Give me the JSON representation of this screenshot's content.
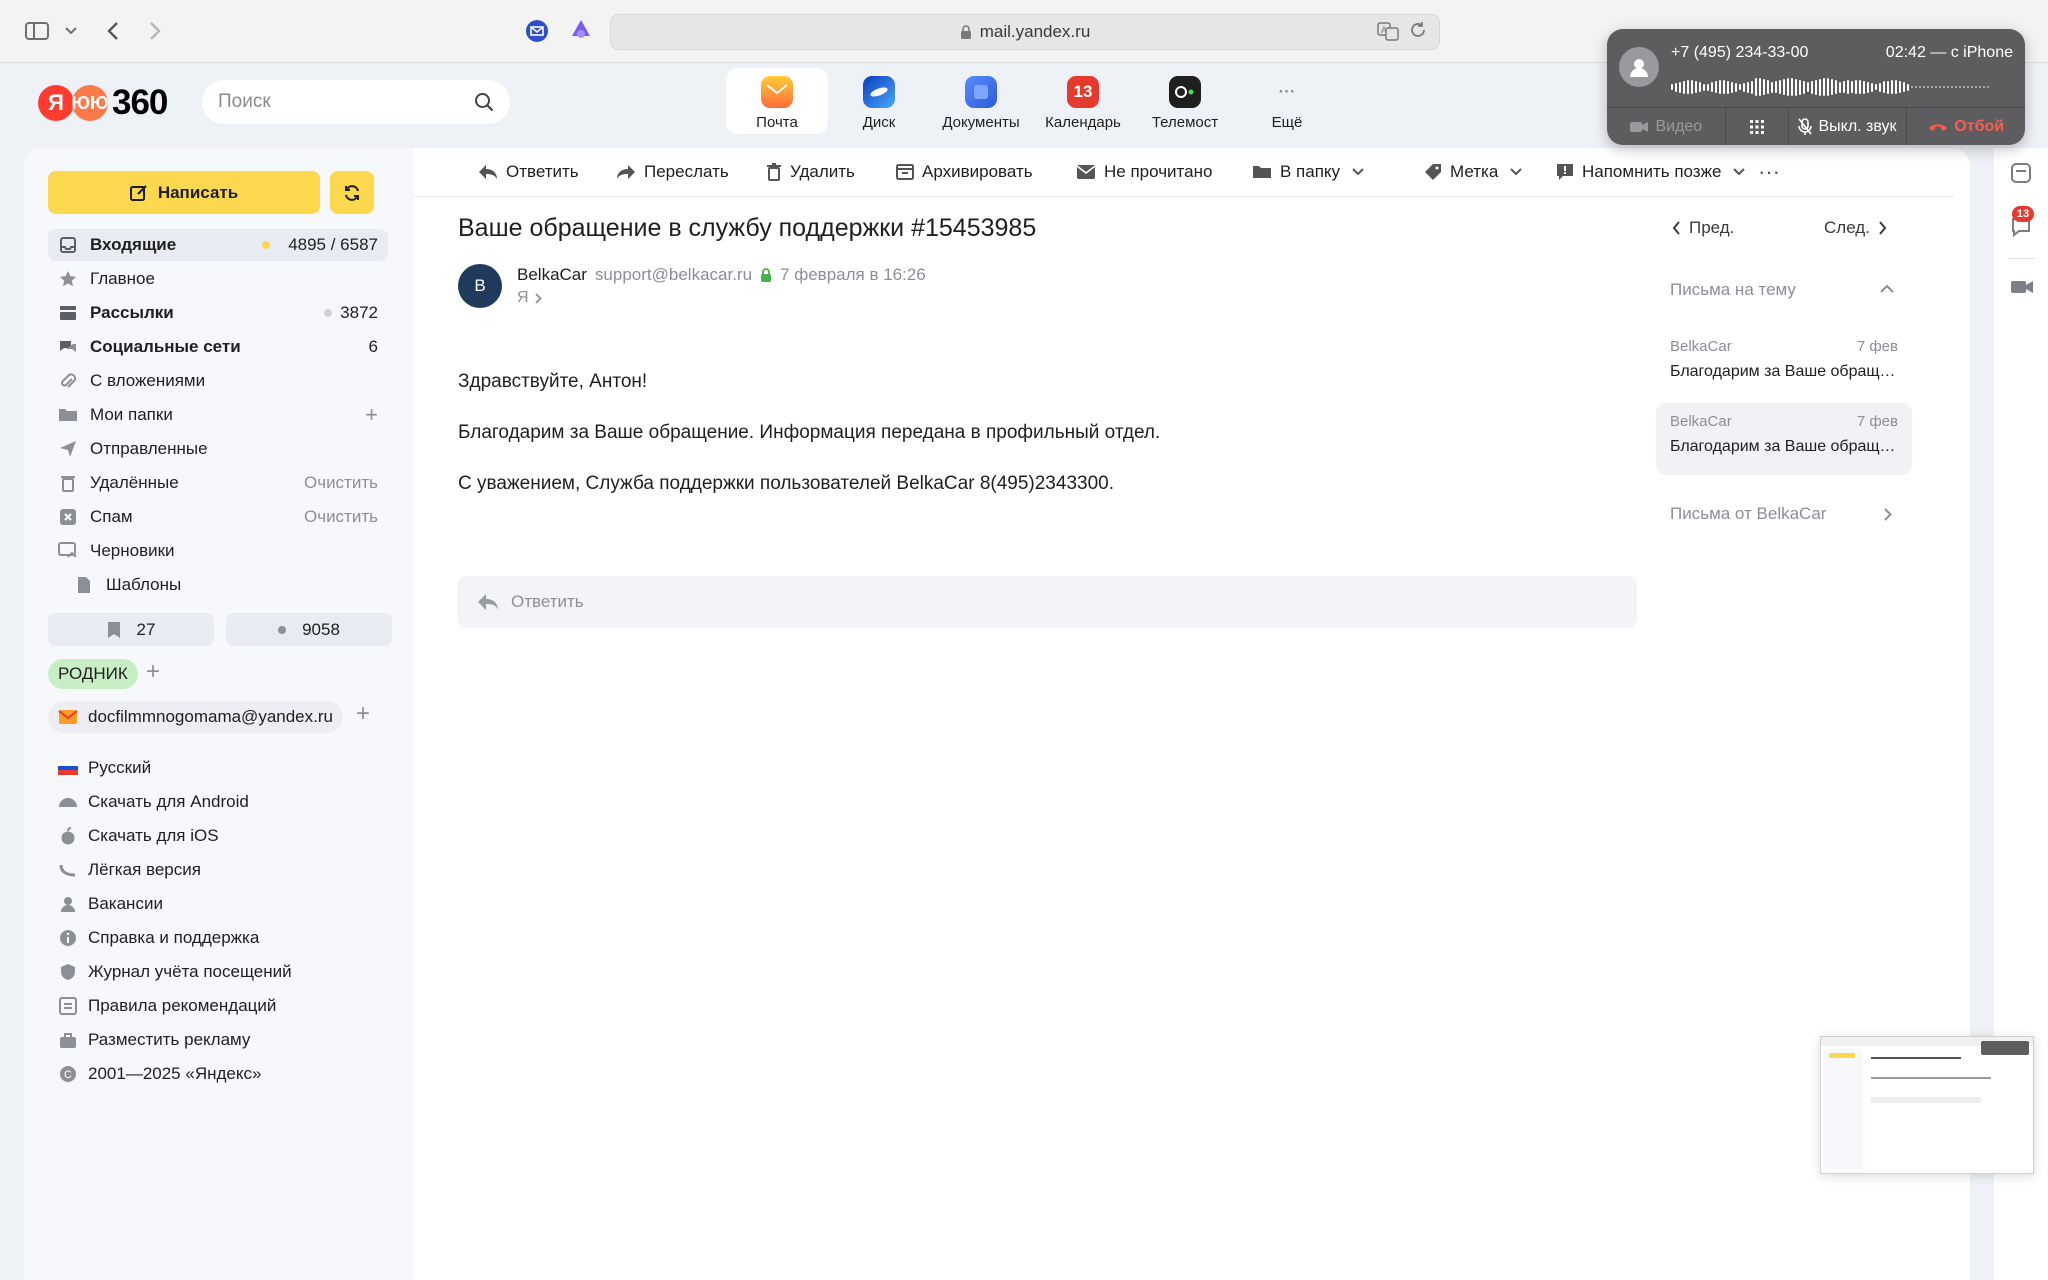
{
  "browser": {
    "url": "mail.yandex.ru"
  },
  "header": {
    "logo_text": "360",
    "logo_letter": "Я",
    "search_placeholder": "Поиск",
    "apps": [
      {
        "label": "Почта",
        "icon": "mail-icon",
        "color": "#ff9b27"
      },
      {
        "label": "Диск",
        "icon": "disk-icon",
        "color": "#1e63e0"
      },
      {
        "label": "Документы",
        "icon": "documents-icon",
        "color": "#3d7bf7"
      },
      {
        "label": "Календарь",
        "icon": "calendar-icon",
        "color": "#e63a2e",
        "badge": "13"
      },
      {
        "label": "Телемост",
        "icon": "telemost-icon",
        "color": "#1f1f1f"
      },
      {
        "label": "Ещё",
        "icon": "more-icon",
        "color": "#8d8f96"
      }
    ]
  },
  "call": {
    "number": "+7 (495) 234-33-00",
    "time": "02:42 — с iPhone",
    "video": "Видео",
    "mute": "Выкл. звук",
    "end": "Отбой"
  },
  "sidebar": {
    "compose": "Написать",
    "folders": [
      {
        "label": "Входящие",
        "bold": true,
        "count": "4895 / 6587",
        "icon": "inbox-icon"
      },
      {
        "label": "Главное",
        "bold": false,
        "count": "",
        "icon": "star-icon"
      },
      {
        "label": "Рассылки",
        "bold": true,
        "count": "3872",
        "icon": "newsletters-icon"
      },
      {
        "label": "Социальные сети",
        "bold": true,
        "count": "6",
        "icon": "social-icon"
      },
      {
        "label": "С вложениями",
        "bold": false,
        "count": "",
        "icon": "attachment-icon"
      },
      {
        "label": "Мои папки",
        "bold": false,
        "count": "",
        "icon": "folders-icon"
      },
      {
        "label": "Отправленные",
        "bold": false,
        "count": "",
        "icon": "sent-icon"
      },
      {
        "label": "Удалённые",
        "bold": false,
        "count": "Очистить",
        "icon": "trash-icon"
      },
      {
        "label": "Спам",
        "bold": false,
        "count": "Очистить",
        "icon": "spam-icon"
      },
      {
        "label": "Черновики",
        "bold": false,
        "count": "",
        "icon": "drafts-icon"
      },
      {
        "label": "Шаблоны",
        "bold": false,
        "count": "",
        "icon": "templates-icon"
      }
    ],
    "bookmarks_count": "27",
    "unread_count": "9058",
    "label_tag": "РОДНИК",
    "account": "docfilmmnogomama@yandex.ru",
    "footer": [
      {
        "label": "Русский",
        "icon": "flag-ru-icon"
      },
      {
        "label": "Скачать для Android",
        "icon": "android-icon"
      },
      {
        "label": "Скачать для iOS",
        "icon": "apple-icon"
      },
      {
        "label": "Лёгкая версия",
        "icon": "light-version-icon"
      },
      {
        "label": "Вакансии",
        "icon": "vacancies-icon"
      },
      {
        "label": "Справка и поддержка",
        "icon": "help-icon"
      },
      {
        "label": "Журнал учёта посещений",
        "icon": "shield-icon"
      },
      {
        "label": "Правила рекомендаций",
        "icon": "rules-icon"
      },
      {
        "label": "Разместить рекламу",
        "icon": "ads-icon"
      },
      {
        "label": "2001—2025 «Яндекс»",
        "icon": "copyright-icon"
      }
    ]
  },
  "toolbar": {
    "reply": "Ответить",
    "forward": "Переслать",
    "delete": "Удалить",
    "archive": "Архивировать",
    "unread": "Не прочитано",
    "to_folder": "В папку",
    "label": "Метка",
    "remind": "Напомнить позже"
  },
  "message": {
    "subject": "Ваше обращение в службу поддержки #15453985",
    "avatar_letter": "B",
    "sender_name": "BelkaCar",
    "sender_email": "support@belkacar.ru",
    "date": "7 февраля в 16:26",
    "to": "Я",
    "greeting": "Здравствуйте, Антон!",
    "body": "Благодарим за Ваше обращение. Информация передана в профильный отдел.",
    "signature": "С уважением, Служба поддержки пользователей BelkaCar 8(495)2343300.",
    "reply_placeholder": "Ответить"
  },
  "thread": {
    "prev": "Пред.",
    "next": "След.",
    "header": "Письма на тему",
    "items": [
      {
        "from": "BelkaCar",
        "date": "7 фев",
        "subject": "Благодарим за Ваше обращение."
      },
      {
        "from": "BelkaCar",
        "date": "7 фев",
        "subject": "Благодарим за Ваше обращение."
      }
    ],
    "from_link": "Письма от BelkaCar"
  },
  "rail": {
    "badge": "13"
  }
}
